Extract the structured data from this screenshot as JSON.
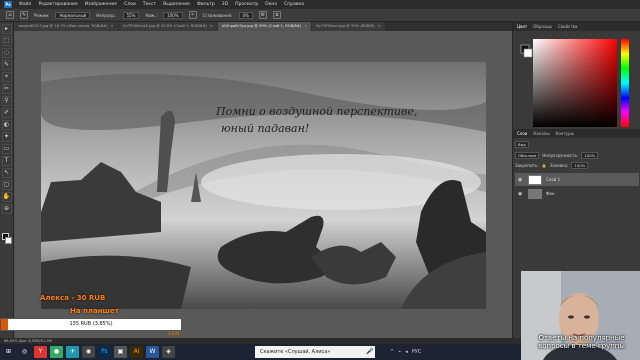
{
  "menubar": {
    "logo": "Ps",
    "items": [
      "Файл",
      "Редактирование",
      "Изображение",
      "Слои",
      "Текст",
      "Выделение",
      "Фильтр",
      "3D",
      "Просмотр",
      "Окно",
      "Справка"
    ]
  },
  "options": {
    "mode_label": "Режим:",
    "mode_value": "Нормальный",
    "opacity_label": "Непрозр.:",
    "opacity_value": "55%",
    "flow_label": "Наж.:",
    "flow_value": "100%",
    "smooth_label": "Сглаживание:",
    "smooth_value": "0%"
  },
  "tabs": [
    {
      "label": "задний2017.jpg @ 16,7% (Фон копия, RGB/8#)",
      "active": false
    },
    {
      "label": "GyTPOXkLeLE.jpg @ 42,6% (Слой 1, RGB/8#)",
      "active": false
    },
    {
      "label": "IAGhpaBr3yo.jpg @ 59% (Слой 1, RGB/8#)",
      "active": true
    },
    {
      "label": "By79TDwvv.jpg @ 39% (RGB/8)",
      "active": false
    }
  ],
  "tools": [
    "▸",
    "⬚",
    "◌",
    "✎",
    "⌖",
    "✂",
    "⚲",
    "✐",
    "◐",
    "✦",
    "▭",
    "T",
    "↖",
    "▢",
    "✋",
    "⊕"
  ],
  "canvas": {
    "line1": "Помни о воздушной перспективе,",
    "line2": "юный падаван!"
  },
  "color_panel": {
    "tabs": [
      "Цвет",
      "Образцы",
      "Свойства"
    ],
    "hue_hex": "#ff0000"
  },
  "layers_panel": {
    "tabs": [
      "Слои",
      "Каналы",
      "Контуры"
    ],
    "kind": "Вид",
    "blend": "Обычные",
    "opacity_label": "Непрозрачность:",
    "opacity_value": "100%",
    "lock_label": "Закрепить:",
    "fill_label": "Заливка:",
    "fill_value": "100%",
    "layers": [
      {
        "name": "Слой 1",
        "selected": true
      },
      {
        "name": "Фон",
        "selected": false
      }
    ]
  },
  "status": "66,05%    Док: 6,59M/51,3M",
  "taskbar": {
    "search": "Скажите «Слушай, Алиса»",
    "icons": [
      "⊞",
      "◎",
      "Y",
      "●",
      "✈",
      "◉",
      "Ps",
      "▣",
      "Ai",
      "W",
      "◈"
    ],
    "tray": [
      "^",
      "⌁",
      "◂",
      "РУС"
    ]
  },
  "overlay": {
    "donor": "Алекса - 30 RUB",
    "donor_note": "На планшет",
    "goal_text": "135 RUB (3.85%)",
    "goal_fraction": 0.0385,
    "goal_edge": "3,500",
    "cam_caption": "Ответы на популярные вопросы в теме группы"
  }
}
